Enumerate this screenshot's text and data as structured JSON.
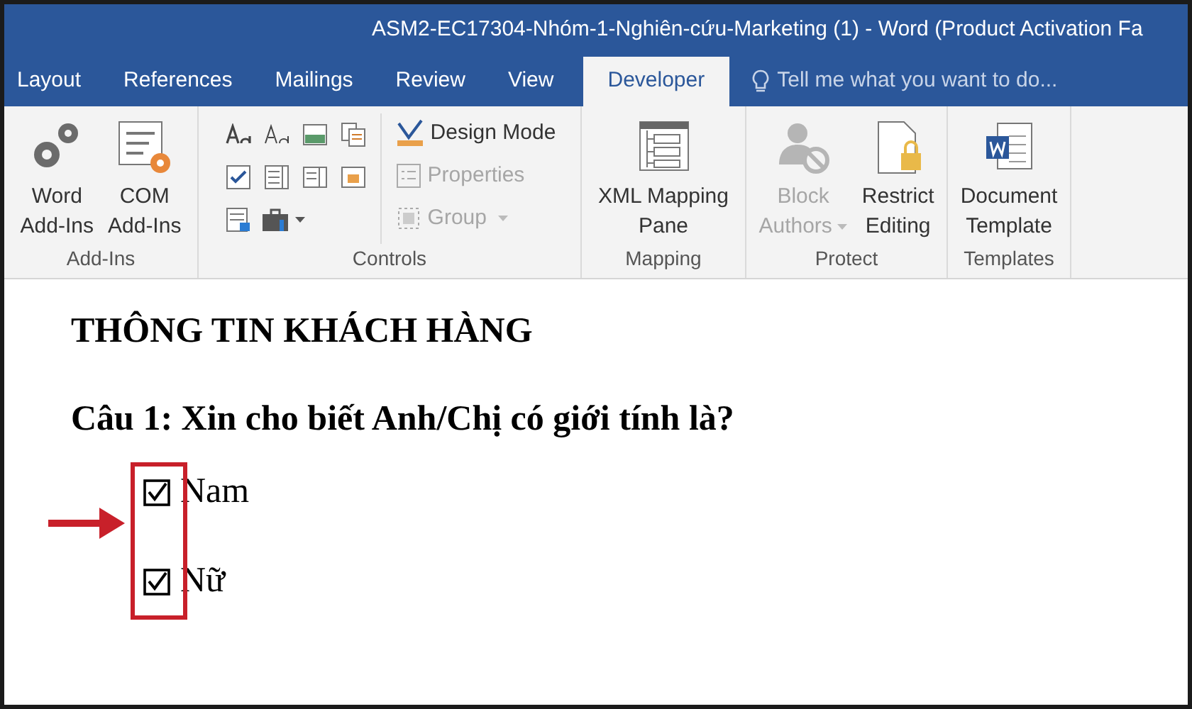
{
  "window": {
    "title": "ASM2-EC17304-Nhóm-1-Nghiên-cứu-Marketing (1) - Word (Product Activation Fa"
  },
  "tabs": [
    {
      "label": "Layout",
      "selected": false
    },
    {
      "label": "References",
      "selected": false
    },
    {
      "label": "Mailings",
      "selected": false
    },
    {
      "label": "Review",
      "selected": false
    },
    {
      "label": "View",
      "selected": false
    },
    {
      "label": "Developer",
      "selected": true
    }
  ],
  "search": {
    "placeholder": "Tell me what you want to do..."
  },
  "ribbon": {
    "groups": [
      {
        "label": "Add-Ins",
        "items": [
          {
            "kind": "large",
            "lines": [
              "Word",
              "Add-Ins"
            ],
            "disabled": false,
            "dropdown": false
          },
          {
            "kind": "large",
            "lines": [
              "COM",
              "Add-Ins"
            ],
            "disabled": false,
            "dropdown": false
          }
        ]
      },
      {
        "label": "Controls",
        "items": [
          {
            "kind": "small",
            "label": "Design Mode",
            "disabled": false,
            "dropdown": false
          },
          {
            "kind": "small",
            "label": "Properties",
            "disabled": true,
            "dropdown": false
          },
          {
            "kind": "small",
            "label": "Group",
            "disabled": true,
            "dropdown": true
          }
        ]
      },
      {
        "label": "Mapping",
        "items": [
          {
            "kind": "large",
            "lines": [
              "XML Mapping",
              "Pane"
            ],
            "disabled": false,
            "dropdown": false
          }
        ]
      },
      {
        "label": "Protect",
        "items": [
          {
            "kind": "large",
            "lines": [
              "Block",
              "Authors"
            ],
            "disabled": true,
            "dropdown": true
          },
          {
            "kind": "large",
            "lines": [
              "Restrict",
              "Editing"
            ],
            "disabled": false,
            "dropdown": false
          }
        ]
      },
      {
        "label": "Templates",
        "items": [
          {
            "kind": "large",
            "lines": [
              "Document",
              "Template"
            ],
            "disabled": false,
            "dropdown": false
          }
        ]
      }
    ]
  },
  "document": {
    "heading": "THÔNG TIN KHÁCH HÀNG",
    "question": "Câu 1: Xin cho biết Anh/Chị có giới tính là?",
    "options": [
      {
        "label": "Nam",
        "checked": true
      },
      {
        "label": "Nữ",
        "checked": true
      }
    ]
  }
}
